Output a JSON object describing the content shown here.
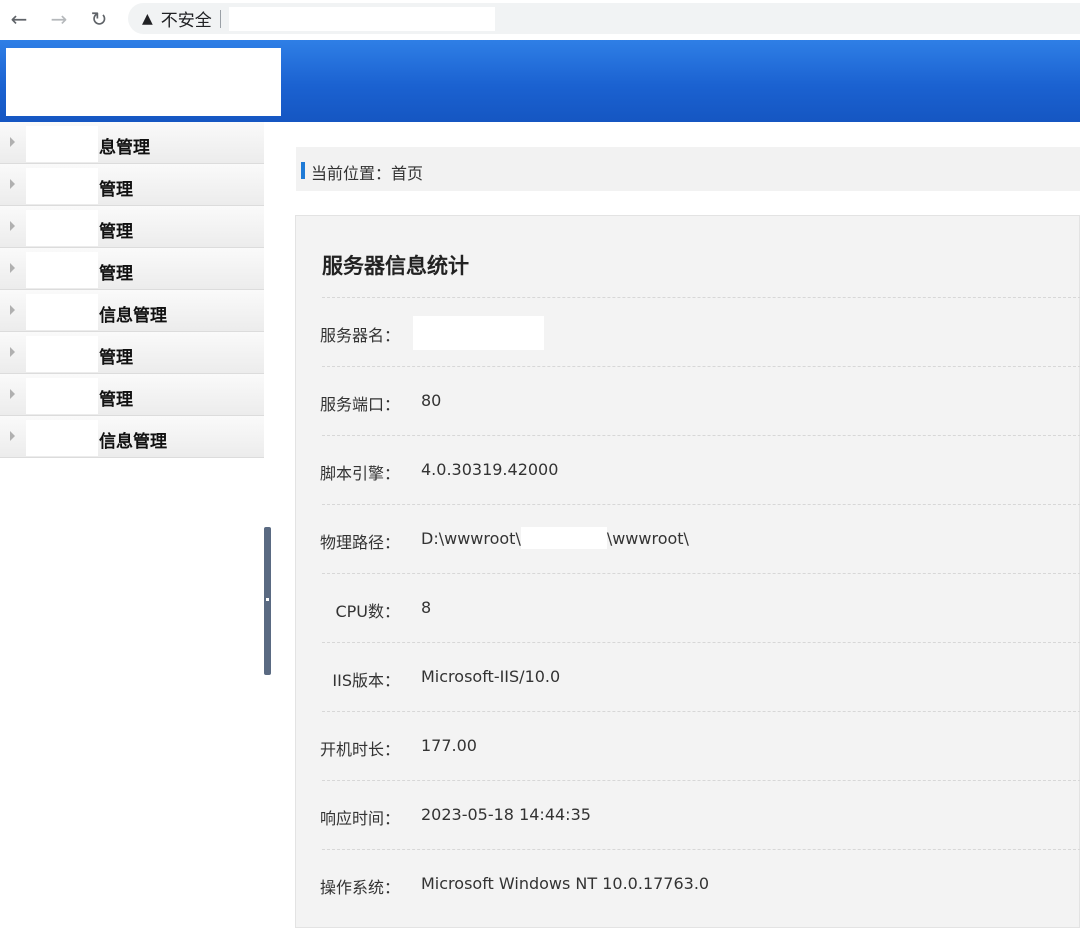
{
  "browser": {
    "back_icon": "arrow-left-icon",
    "forward_icon": "arrow-right-icon",
    "reload_icon": "reload-icon",
    "warning_icon": "warning-triangle-icon",
    "insecure_label": "不安全"
  },
  "sidebar": {
    "items": [
      {
        "label": "息管理"
      },
      {
        "label": "管理"
      },
      {
        "label": "管理"
      },
      {
        "label": "管理"
      },
      {
        "label": "信息管理"
      },
      {
        "label": "管理"
      },
      {
        "label": "管理"
      },
      {
        "label": "信息管理"
      }
    ]
  },
  "breadcrumb": {
    "text": "当前位置：首页"
  },
  "panel": {
    "title": "服务器信息统计",
    "rows": [
      {
        "key": "服务器名：",
        "value": ""
      },
      {
        "key": "服务端口：",
        "value": "80"
      },
      {
        "key": "脚本引擎：",
        "value": "4.0.30319.42000"
      },
      {
        "key": "物理路径：",
        "value_prefix": "D:\\wwwroot\\",
        "value_suffix": "\\wwwroot\\"
      },
      {
        "key": "CPU数：",
        "value": "8"
      },
      {
        "key": "IIS版本：",
        "value": "Microsoft-IIS/10.0"
      },
      {
        "key": "开机时长：",
        "value": "177.00"
      },
      {
        "key": "响应时间：",
        "value": "2023-05-18 14:44:35"
      },
      {
        "key": "操作系统：",
        "value": "Microsoft Windows NT 10.0.17763.0"
      }
    ]
  },
  "colors": {
    "header_blue": "#1b62d1",
    "accent_blue": "#1e7ad6",
    "splitter": "#5a6a82"
  }
}
